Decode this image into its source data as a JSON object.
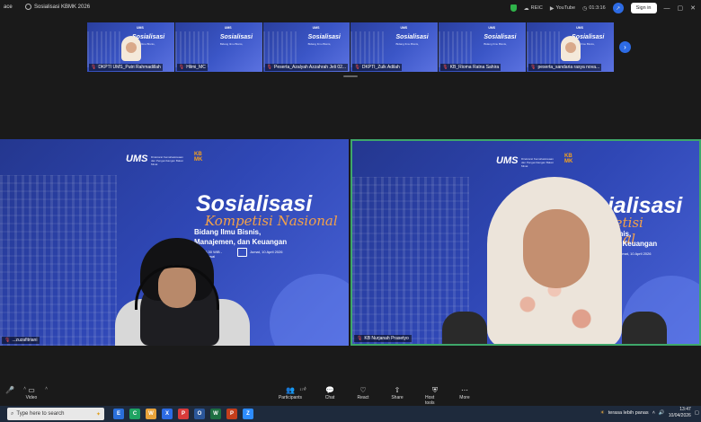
{
  "topbar": {
    "app_title": "ace",
    "meeting_title": "Sosialisasi KBMK 2026",
    "tools": [
      {
        "icon": "cloud-icon",
        "label": "REIC"
      },
      {
        "icon": "youtube-icon",
        "label": "YouTube"
      },
      {
        "icon": "timer-icon",
        "label": "01:3:16"
      }
    ],
    "signin_label": "Sign in",
    "window_controls": [
      "—",
      "▢",
      "✕"
    ]
  },
  "thumbnails": [
    {
      "name": "DKPTI UMS_Putri Rahmadillah",
      "title": "Sosialisasi",
      "has_face": true
    },
    {
      "name": "Hilmi_MC",
      "title": "Sosialisasi",
      "has_face": false
    },
    {
      "name": "Peserta_Azalyah Azzahrah Jeli 02...",
      "title": "Sosialisasi",
      "has_face": false
    },
    {
      "name": "DKPTI_Zulk Adilah",
      "title": "Sosialisasi",
      "has_face": false
    },
    {
      "name": "KB_Rioma Ratna Sahira",
      "title": "Sosialisasi",
      "has_face": false
    },
    {
      "name": "peserta_sandaria rasya nova...",
      "title": "Sosialisasi",
      "has_face": true
    }
  ],
  "slide": {
    "logo": "UMS",
    "logo_sub": "Direktorat Kemahasiswaan dan Pengembangan Bakat Minat",
    "kb_logo_line1": "KB",
    "kb_logo_line2": "MK",
    "title": "Sosialisasi",
    "subtitle": "Kompetisi Nasional",
    "line1": "Bidang Ilmu Bisnis,",
    "line2": "Manajemen, dan Keuangan",
    "date_text": "Jumat, 10 April 2026",
    "time_text": "13.30 WIB - Selesai"
  },
  "videos": [
    {
      "name": "...zuzafitriani"
    },
    {
      "name": "KB Nurjanah Prasetyo"
    }
  ],
  "controls": [
    {
      "icon": "mic-icon",
      "label": "",
      "glyph": "🎤"
    },
    {
      "icon": "video-camera-icon",
      "label": "Video",
      "glyph": "▭"
    },
    {
      "icon": "participants-icon",
      "label": "Participants",
      "glyph": "👥",
      "count": "179"
    },
    {
      "icon": "chat-icon",
      "label": "Chat",
      "glyph": "💬"
    },
    {
      "icon": "react-icon",
      "label": "React",
      "glyph": "♡"
    },
    {
      "icon": "share-icon",
      "label": "Share",
      "glyph": "⇧"
    },
    {
      "icon": "host-tools-icon",
      "label": "Host tools",
      "glyph": "⛨"
    },
    {
      "icon": "more-icon",
      "label": "More",
      "glyph": "⋯"
    }
  ],
  "taskbar": {
    "search_placeholder": "Type here to search",
    "apps": [
      "E",
      "C",
      "W",
      "X",
      "P",
      "O",
      "W",
      "P",
      "Z"
    ],
    "weather": "terasa lebih panas",
    "time": "13:47",
    "date": "10/04/2026"
  },
  "colors": {
    "accent_blue": "#2d6be4",
    "speaker_border": "#3ea76a",
    "slide_bg": "#2f47b5",
    "subtitle_orange": "#f2a14a"
  }
}
